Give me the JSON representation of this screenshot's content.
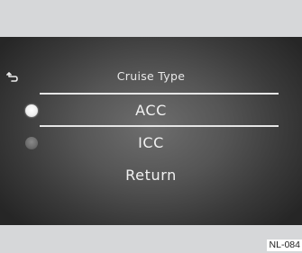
{
  "menu": {
    "title": "Cruise Type",
    "back_icon": "back-arrow-icon",
    "options": [
      {
        "label": "ACC",
        "selected": true
      },
      {
        "label": "ICC",
        "selected": false
      },
      {
        "label": "Return"
      }
    ]
  },
  "figure": {
    "reference_code": "NL-084"
  },
  "colors": {
    "text": "#f2f2f2",
    "divider": "#e6e6e6",
    "radio_selected": "#ffffff",
    "radio_unselected": "#6b6b6b",
    "frame": "#d6d7d9"
  }
}
